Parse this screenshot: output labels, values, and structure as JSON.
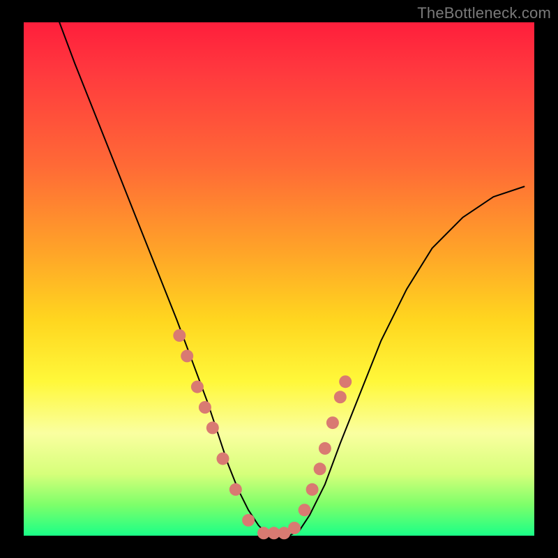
{
  "watermark": "TheBottleneck.com",
  "chart_data": {
    "type": "line",
    "title": "",
    "xlabel": "",
    "ylabel": "",
    "xlim": [
      0,
      100
    ],
    "ylim": [
      0,
      100
    ],
    "series": [
      {
        "name": "bottleneck-curve",
        "x": [
          7,
          10,
          14,
          18,
          22,
          26,
          30,
          33,
          36,
          38,
          40,
          42,
          44,
          46,
          48,
          50,
          52,
          54,
          56,
          59,
          62,
          66,
          70,
          75,
          80,
          86,
          92,
          98
        ],
        "y": [
          100,
          92,
          82,
          72,
          62,
          52,
          42,
          34,
          26,
          20,
          14,
          9,
          5,
          2,
          0,
          0,
          0,
          1,
          4,
          10,
          18,
          28,
          38,
          48,
          56,
          62,
          66,
          68
        ]
      }
    ],
    "markers": {
      "name": "highlight-dots",
      "x": [
        30.5,
        32,
        34,
        35.5,
        37,
        39,
        41.5,
        44,
        47,
        49,
        51,
        53,
        55,
        56.5,
        58,
        59,
        60.5,
        62,
        63
      ],
      "y": [
        39,
        35,
        29,
        25,
        21,
        15,
        9,
        3,
        0.5,
        0.5,
        0.5,
        1.5,
        5,
        9,
        13,
        17,
        22,
        27,
        30
      ]
    }
  }
}
